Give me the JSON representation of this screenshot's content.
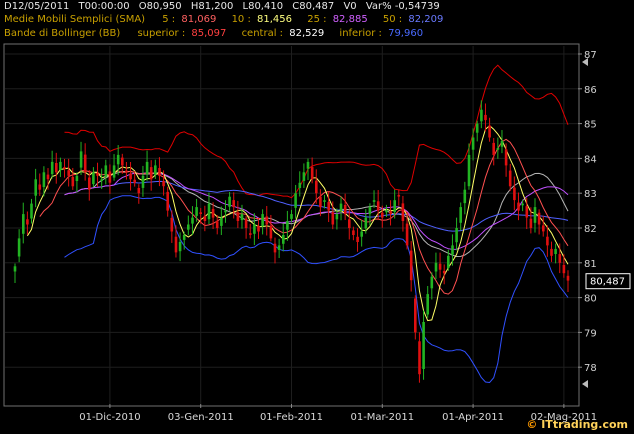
{
  "header": {
    "row1": {
      "date": "D12/05/2011",
      "time": "T00:00:00",
      "open": "O80,950",
      "high": "H81,200",
      "low": "L80,410",
      "close": "C80,487",
      "volume": "V0",
      "var": "Var% -0,54739"
    },
    "sma": {
      "label": "Medie Mobili Semplici (SMA)",
      "p5_label": "5 :",
      "p5_value": "81,069",
      "p10_label": "10 :",
      "p10_value": "81,456",
      "p25_label": "25 :",
      "p25_value": "82,885",
      "p50_label": "50 :",
      "p50_value": "82,209"
    },
    "bb": {
      "label": "Bande di Bollinger (BB)",
      "sup_label": "superior :",
      "sup_value": "85,097",
      "cen_label": "central :",
      "cen_value": "82,529",
      "inf_label": "inferior :",
      "inf_value": "79,960"
    }
  },
  "last_price_label": "80,487",
  "brand": {
    "prefix": "© ",
    "name": "ITtrading.com"
  },
  "colors": {
    "up": "#22b422",
    "down": "#e01010",
    "sma5": "#ffff66",
    "sma10": "#ff5050",
    "sma25": "#c050ff",
    "sma50": "#5060ff",
    "bb_sup": "#e00000",
    "bb_cen": "#ffffff",
    "bb_inf": "#3050ff"
  },
  "chart_data": {
    "type": "candlestick",
    "ylim": [
      77,
      87
    ],
    "yticks": [
      "78",
      "79",
      "80",
      "81",
      "82",
      "83",
      "84",
      "85",
      "86",
      "87"
    ],
    "xtick_labels": [
      "01-Dic-2010",
      "03-Gen-2011",
      "01-Feb-2011",
      "01-Mar-2011",
      "01-Apr-2011",
      "02-Mag-2011"
    ],
    "xtick_index": [
      23,
      45,
      67,
      89,
      111,
      133
    ],
    "close": [
      80.9,
      81.7,
      82.4,
      82.1,
      82.7,
      83.4,
      83.1,
      83.6,
      83.4,
      83.9,
      83.6,
      83.9,
      83.7,
      83.5,
      83.2,
      83.5,
      84.2,
      83.6,
      83.1,
      83.6,
      83.5,
      83.4,
      83.8,
      83.3,
      83.8,
      84.1,
      83.8,
      83.6,
      83.4,
      83.3,
      83.0,
      83.5,
      83.9,
      83.4,
      83.8,
      83.5,
      83.2,
      82.5,
      81.9,
      81.3,
      81.6,
      81.8,
      82.1,
      82.3,
      82.6,
      82.4,
      82.2,
      82.7,
      82.3,
      82.0,
      82.3,
      82.5,
      82.9,
      82.6,
      82.2,
      82.4,
      82.0,
      81.8,
      82.1,
      81.9,
      82.4,
      82.1,
      81.7,
      81.3,
      81.5,
      81.8,
      82.2,
      82.4,
      83.0,
      83.3,
      83.6,
      83.9,
      83.4,
      83.0,
      82.6,
      82.8,
      82.5,
      82.1,
      82.4,
      82.7,
      82.4,
      82.0,
      81.8,
      81.6,
      81.9,
      82.3,
      82.6,
      82.8,
      82.5,
      82.3,
      82.5,
      82.4,
      82.8,
      82.9,
      82.2,
      81.5,
      80.5,
      79.0,
      77.8,
      79.3,
      80.1,
      80.6,
      81.0,
      80.8,
      80.7,
      81.2,
      81.5,
      82.0,
      82.6,
      83.1,
      84.1,
      84.6,
      85.0,
      85.4,
      85.1,
      84.6,
      84.1,
      84.3,
      84.5,
      83.8,
      83.2,
      82.8,
      82.5,
      82.7,
      82.3,
      82.0,
      82.6,
      82.1,
      81.9,
      81.5,
      81.2,
      81.4,
      81.0,
      80.7,
      80.487
    ]
  }
}
